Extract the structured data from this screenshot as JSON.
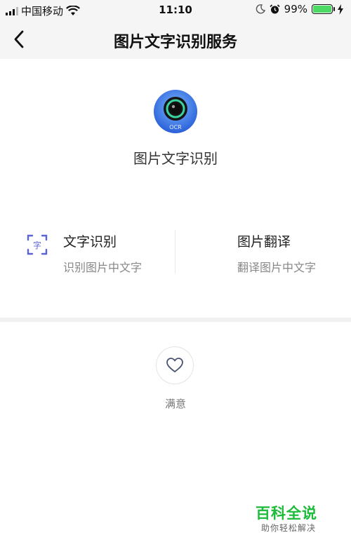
{
  "status_bar": {
    "carrier": "中国移动",
    "time": "11:10",
    "battery_percent": "99%",
    "battery_level": 0.99,
    "icons": [
      "signal-icon",
      "wifi-icon",
      "moon-icon",
      "alarm-icon",
      "battery-icon",
      "charging-icon"
    ]
  },
  "nav": {
    "title": "图片文字识别服务",
    "back_icon": "chevron-left-icon"
  },
  "app": {
    "name": "图片文字识别",
    "icon_label": "OCR",
    "icon_colors": {
      "outer": "#2f7df0",
      "ring": "#3ad3a0",
      "lens": "#111111"
    }
  },
  "features": [
    {
      "title": "文字识别",
      "subtitle": "识别图片中文字",
      "icon": "text-scan-icon",
      "icon_glyph": "字",
      "accent": "#5a64d8"
    },
    {
      "title": "图片翻译",
      "subtitle": "翻译图片中文字"
    }
  ],
  "feedback": {
    "label": "满意",
    "icon": "heart-icon"
  },
  "watermark": {
    "main": "百科全说",
    "sub": "助你轻松解决",
    "color": "#1dbb3a"
  }
}
